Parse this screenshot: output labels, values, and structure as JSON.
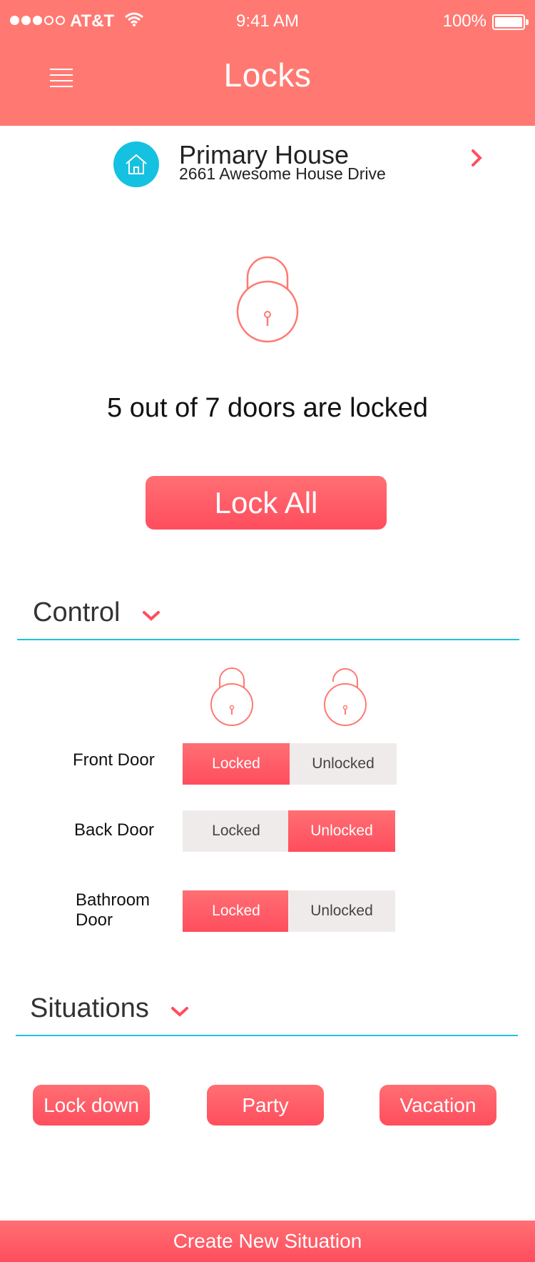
{
  "status_bar": {
    "carrier": "AT&T",
    "time": "9:41 AM",
    "battery": "100%"
  },
  "header": {
    "title": "Locks"
  },
  "house": {
    "name": "Primary House",
    "address": "2661 Awesome House Drive"
  },
  "summary": {
    "status_text": "5 out of 7 doors are locked",
    "lock_all_label": "Lock All"
  },
  "control": {
    "title": "Control",
    "doors": [
      {
        "name": "Front Door",
        "locked_label": "Locked",
        "unlocked_label": "Unlocked",
        "state": "locked"
      },
      {
        "name": "Back Door",
        "locked_label": "Locked",
        "unlocked_label": "Unlocked",
        "state": "unlocked"
      },
      {
        "name": "Bathroom Door",
        "locked_label": "Locked",
        "unlocked_label": "Unlocked",
        "state": "locked"
      }
    ]
  },
  "situations": {
    "title": "Situations",
    "buttons": [
      "Lock down",
      "Party",
      "Vacation"
    ],
    "create_label": "Create New Situation"
  },
  "colors": {
    "header": "#ff7972",
    "accent": "#ff4d5e",
    "divider": "#1ec4d8",
    "house_icon": "#15c1e0",
    "off_segment": "#efebea"
  },
  "icons": [
    "menu-icon",
    "wifi-icon",
    "battery-icon",
    "house-icon",
    "chevron-right-icon",
    "lock-icon",
    "unlocked-icon",
    "chevron-down-icon"
  ]
}
